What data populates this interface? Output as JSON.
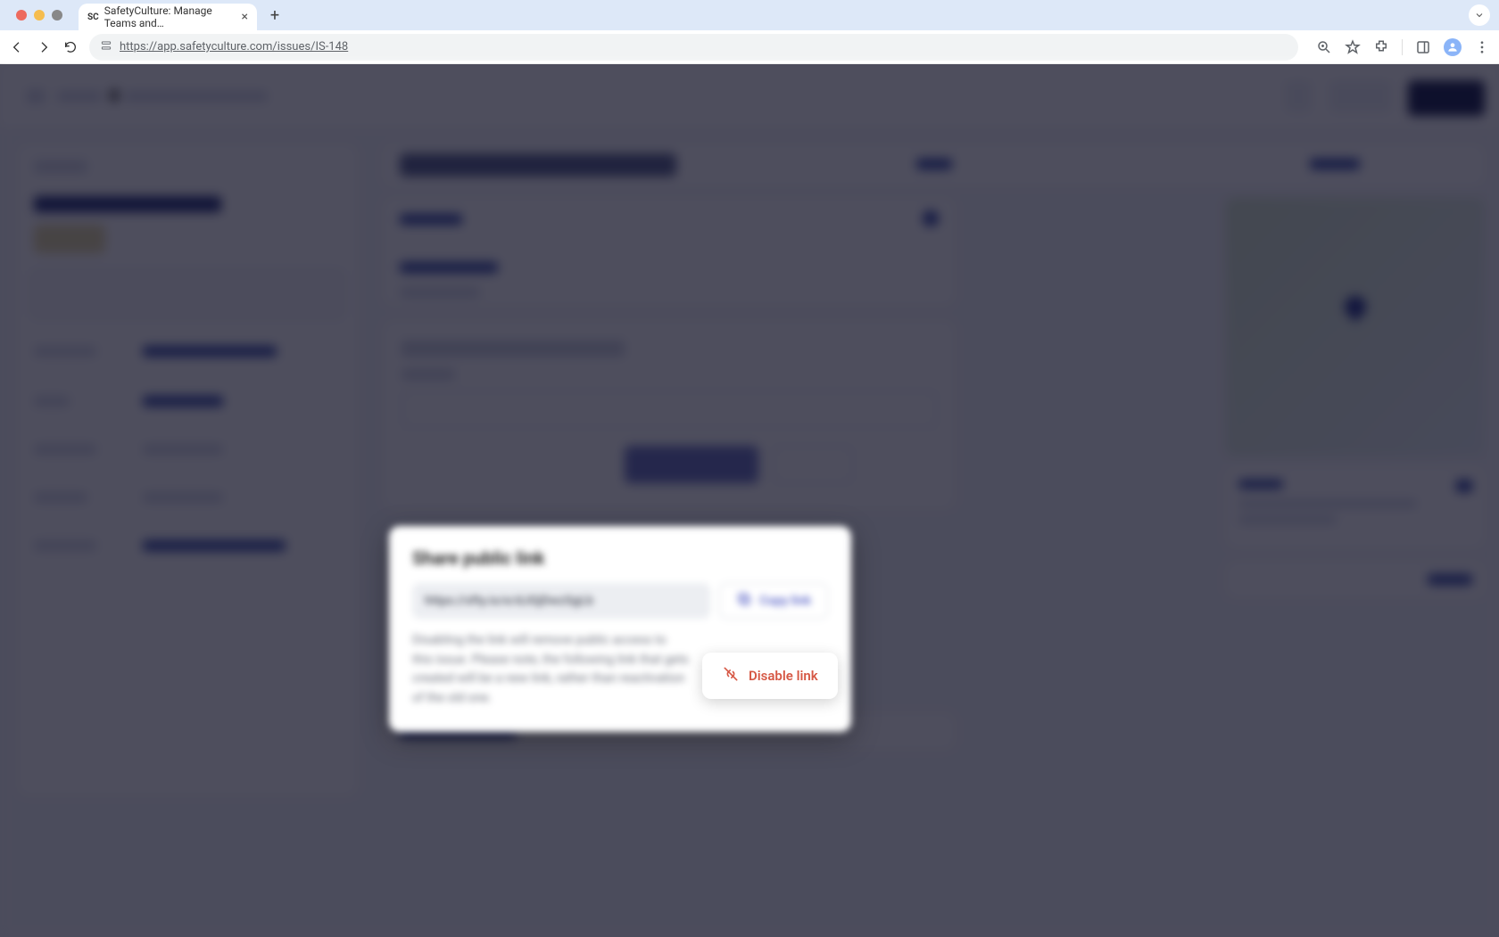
{
  "browser": {
    "tab_title": "SafetyCulture: Manage Teams and…",
    "url": "https://app.safetyculture.com/issues/IS-148"
  },
  "modal": {
    "title": "Share public link",
    "link_value": "https://sfty.io/e/dJGjDwzSgLb",
    "copy_label": "Copy link",
    "helper_text": "Disabling the link will remove public access to this issue. Please note, the following link that gets created will be a new link, rather than reactivation of the old one.",
    "disable_label": "Disable link"
  }
}
